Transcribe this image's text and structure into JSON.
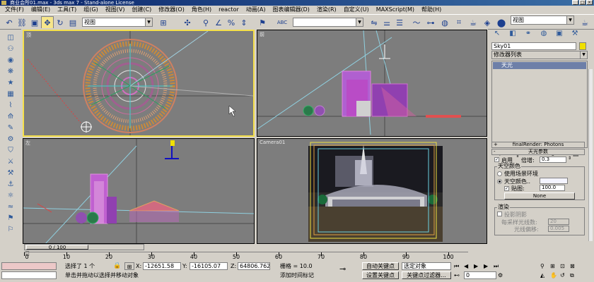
{
  "title": "商业会所01.max - 3ds max 7 - Stand-alone License",
  "window_buttons": [
    "_",
    "□",
    "×"
  ],
  "menu": [
    "文件(F)",
    "编辑(E)",
    "工具(T)",
    "组(G)",
    "视图(V)",
    "创建(C)",
    "修改器(O)",
    "角色(H)",
    "reactor",
    "动画(A)",
    "图表编辑器(D)",
    "渲染(R)",
    "自定义(U)",
    "MAXScript(M)",
    "帮助(H)"
  ],
  "toolbar": {
    "view_combo": "视图",
    "view_combo2": "视图",
    "abc_label": "ABC"
  },
  "viewports": {
    "top": "顶",
    "front": "前",
    "left": "左",
    "camera": "Camera01"
  },
  "command_panel": {
    "object_name": "Sky01",
    "modifier_list": "修改器列表",
    "stack_item": "天光",
    "rollout1": "finalRender: Photons",
    "rollout2": "天光参数",
    "enable_label": "启用",
    "multiplier_label": "倍增:",
    "multiplier_value": "0.3",
    "sky_color_group": "天空颜色",
    "use_env_label": "使用场景环境",
    "sky_color_label": "天空颜色..",
    "map_label": "贴图:",
    "map_value": "100.0",
    "none_button": "None",
    "render_group": "渲染",
    "cast_shadows": "投影阴影",
    "rays_label": "每采样光线数:",
    "rays_value": "20",
    "ray_bias_label": "光线偏移:",
    "ray_bias_value": "0.005"
  },
  "time_slider": "0 / 100",
  "ruler_ticks": [
    "0",
    "10",
    "20",
    "30",
    "40",
    "50",
    "60",
    "70",
    "80",
    "90",
    "100"
  ],
  "status": {
    "selection": "选择了 1 个",
    "x_label": "X:",
    "x_value": "-12651.58",
    "y_label": "Y:",
    "y_value": "-16105.07",
    "z_label": "Z:",
    "z_value": "64806.762",
    "grid": "栅格 = 10.0",
    "auto_key": "自动关键点",
    "set_key": "设置关键点",
    "selected_object": "选定对象",
    "key_filters": "关键点过滤器...",
    "prompt": "单击并拖动以选择并移动对象",
    "add_time_tag": "添加时间标记",
    "frame": "0"
  },
  "colors": {
    "viewport_bg": "#7d7d7d",
    "active_border": "#f5e04a",
    "selection_bar": "#6d7fa8",
    "title_bar": "#0a246a"
  }
}
